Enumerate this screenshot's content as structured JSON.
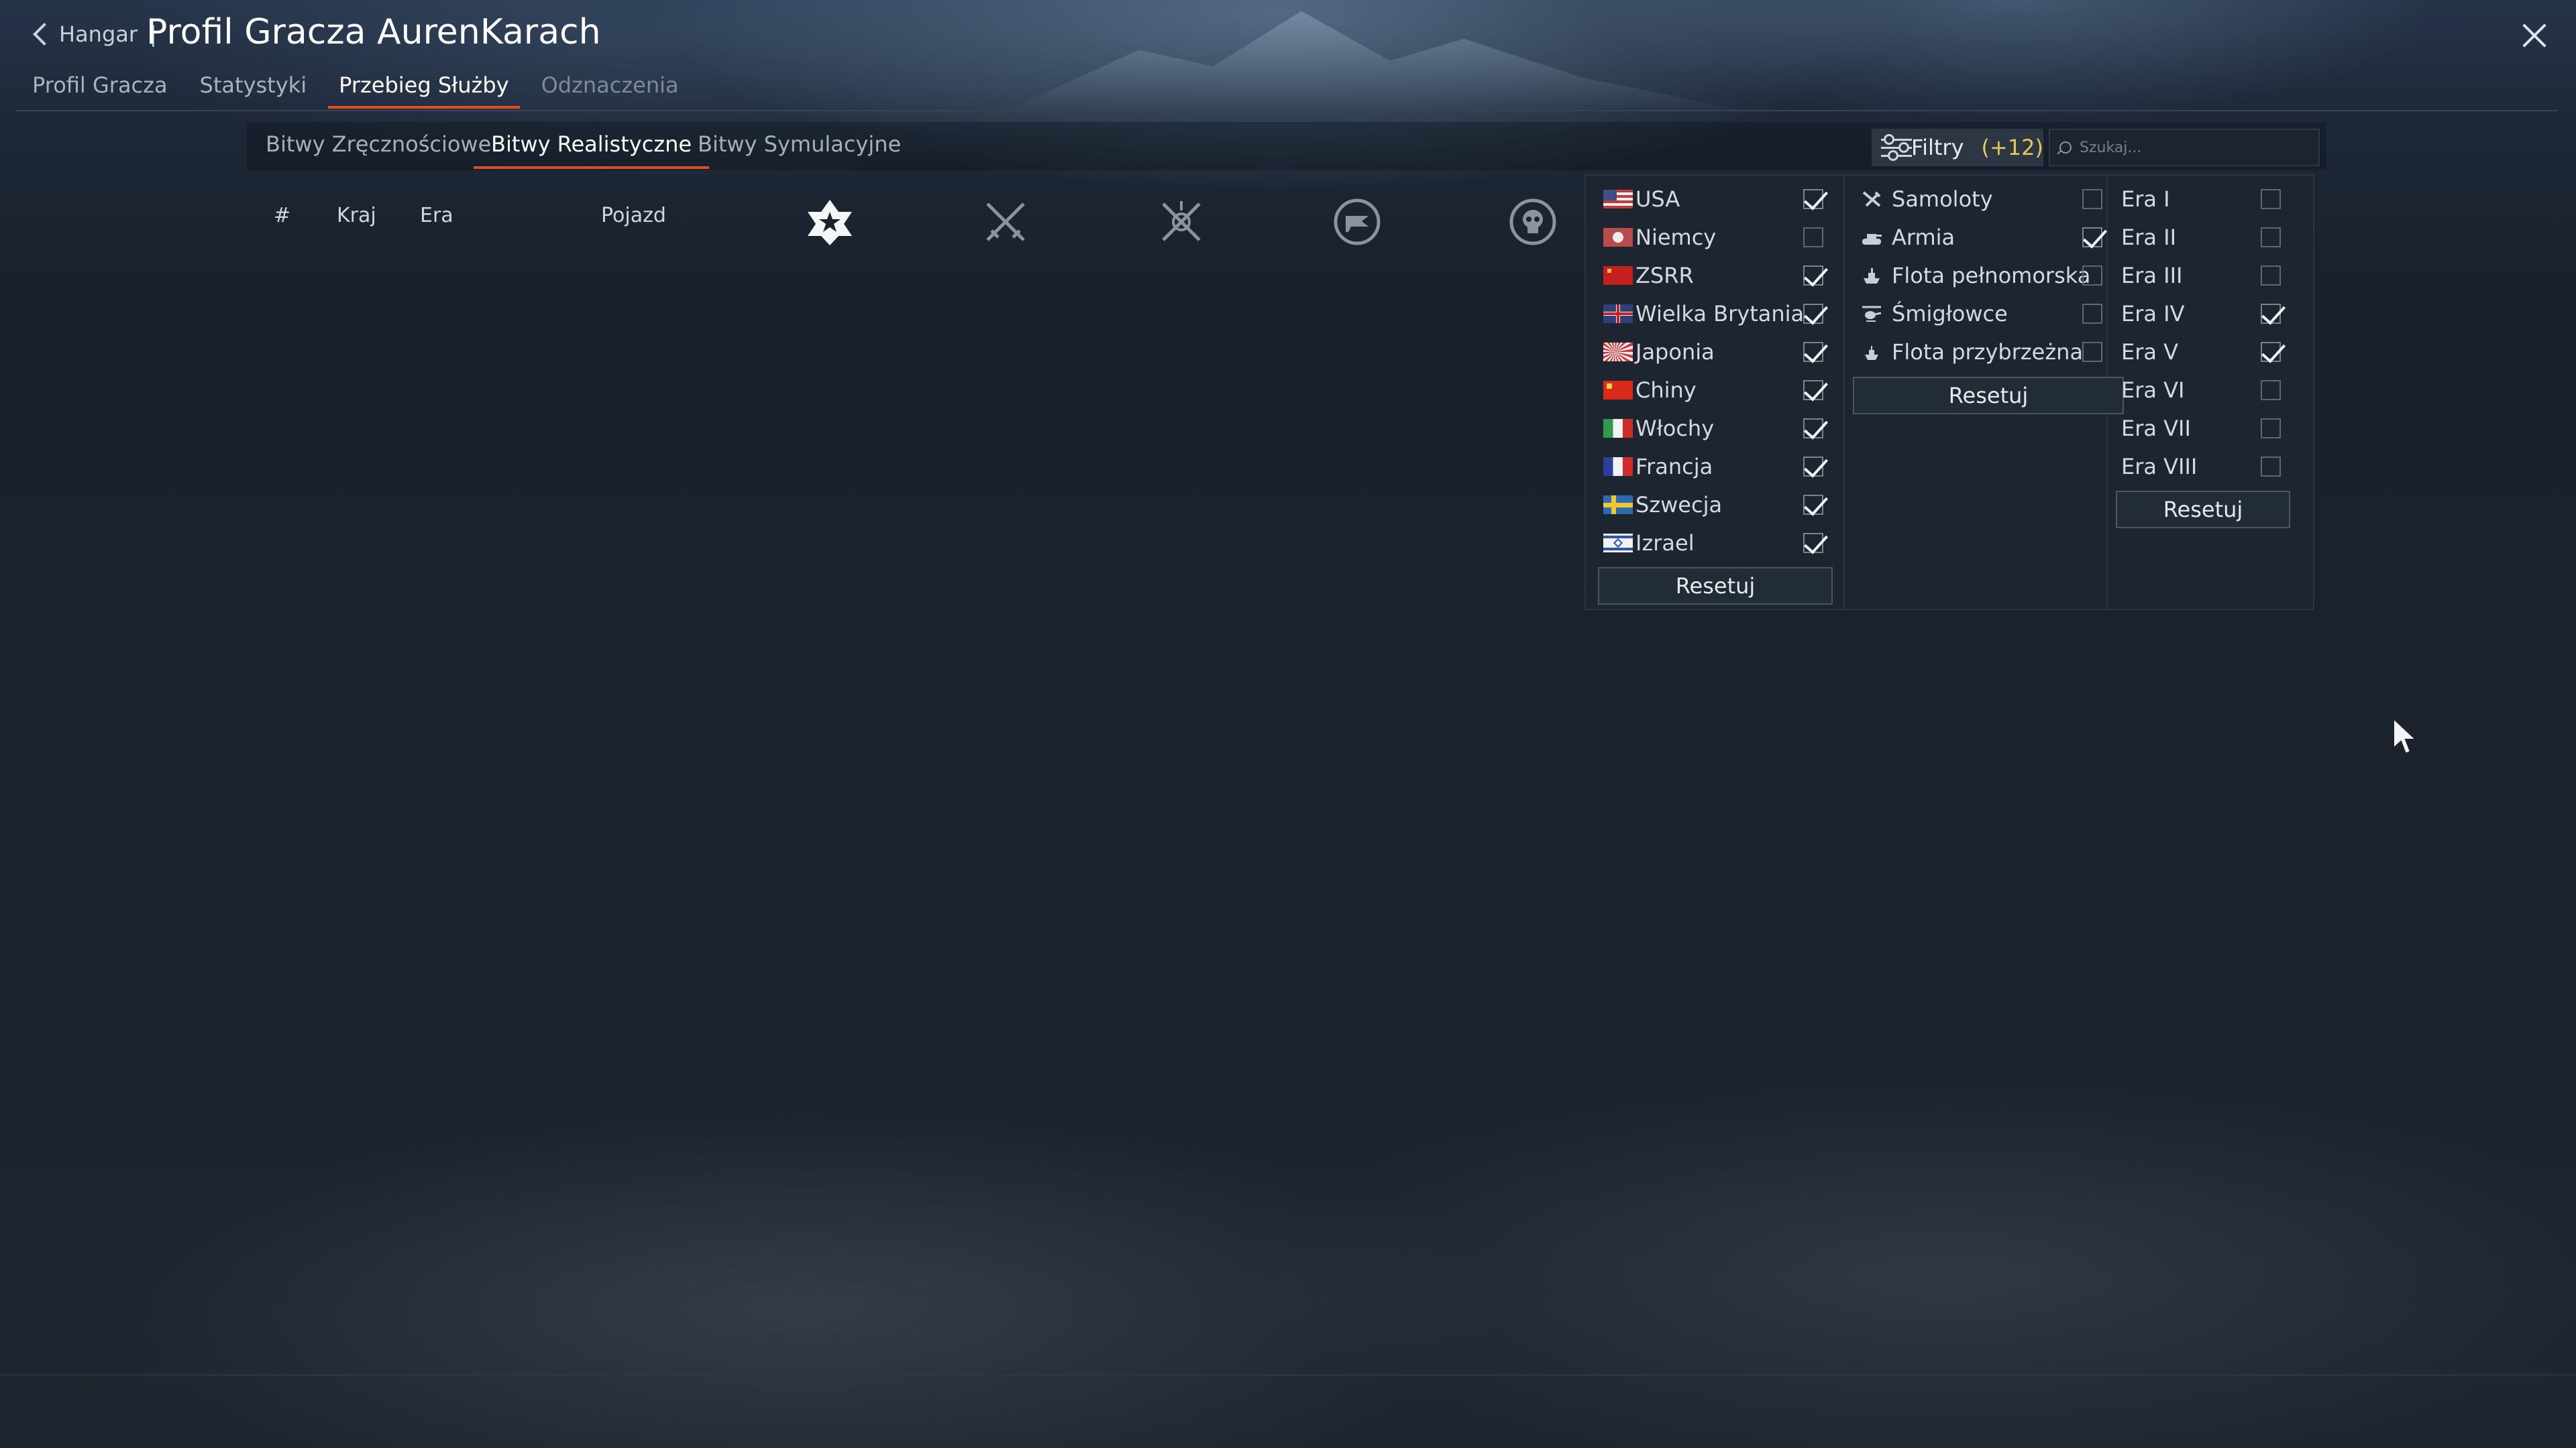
{
  "header": {
    "back_label": "Hangar",
    "separator": "|",
    "title": "Profil Gracza AurenKarach",
    "tabs": [
      {
        "label": "Profil Gracza",
        "active": false
      },
      {
        "label": "Statystyki",
        "active": false
      },
      {
        "label": "Przebieg Służby",
        "active": true
      },
      {
        "label": "Odznaczenia",
        "active": false
      }
    ]
  },
  "subtabs": [
    {
      "label": "Bitwy Zręcznościowe",
      "active": false
    },
    {
      "label": "Bitwy Realistyczne",
      "active": true
    },
    {
      "label": "Bitwy Symulacyjne",
      "active": false
    }
  ],
  "filters": {
    "label": "Filtry",
    "count": "(+12)",
    "search_placeholder": "Szukaj..."
  },
  "table": {
    "columns": [
      "#",
      "Kraj",
      "Era",
      "Pojazd"
    ],
    "icon_columns": [
      "star-medal-icon",
      "crossed-swords-icon",
      "crossed-swords-target-icon",
      "capture-flag-icon",
      "skull-icon"
    ]
  },
  "filter_panel": {
    "countries": [
      {
        "label": "USA",
        "flag": "usa",
        "checked": true
      },
      {
        "label": "Niemcy",
        "flag": "germany",
        "checked": false
      },
      {
        "label": "ZSRR",
        "flag": "ussr",
        "checked": true
      },
      {
        "label": "Wielka Brytania",
        "flag": "uk",
        "checked": true
      },
      {
        "label": "Japonia",
        "flag": "japan",
        "checked": true
      },
      {
        "label": "Chiny",
        "flag": "china",
        "checked": true
      },
      {
        "label": "Włochy",
        "flag": "italy",
        "checked": true
      },
      {
        "label": "Francja",
        "flag": "france",
        "checked": true
      },
      {
        "label": "Szwecja",
        "flag": "sweden",
        "checked": true
      },
      {
        "label": "Izrael",
        "flag": "israel",
        "checked": true
      }
    ],
    "unit_types": [
      {
        "label": "Samoloty",
        "icon": "plane-icon",
        "checked": false
      },
      {
        "label": "Armia",
        "icon": "tank-icon",
        "checked": true
      },
      {
        "label": "Flota pełnomorska",
        "icon": "ship-icon",
        "checked": false
      },
      {
        "label": "Śmigłowce",
        "icon": "helicopter-icon",
        "checked": false
      },
      {
        "label": "Flota przybrzeżna",
        "icon": "boat-icon",
        "checked": false
      }
    ],
    "eras": [
      {
        "label": "Era I",
        "checked": false
      },
      {
        "label": "Era II",
        "checked": false
      },
      {
        "label": "Era III",
        "checked": false
      },
      {
        "label": "Era IV",
        "checked": true
      },
      {
        "label": "Era V",
        "checked": true
      },
      {
        "label": "Era VI",
        "checked": false
      },
      {
        "label": "Era VII",
        "checked": false
      },
      {
        "label": "Era VIII",
        "checked": false
      }
    ],
    "reset_label": "Resetuj"
  },
  "colors": {
    "accent": "#e04d25",
    "count_yellow": "#e8c65a",
    "background": "#1b222c"
  }
}
